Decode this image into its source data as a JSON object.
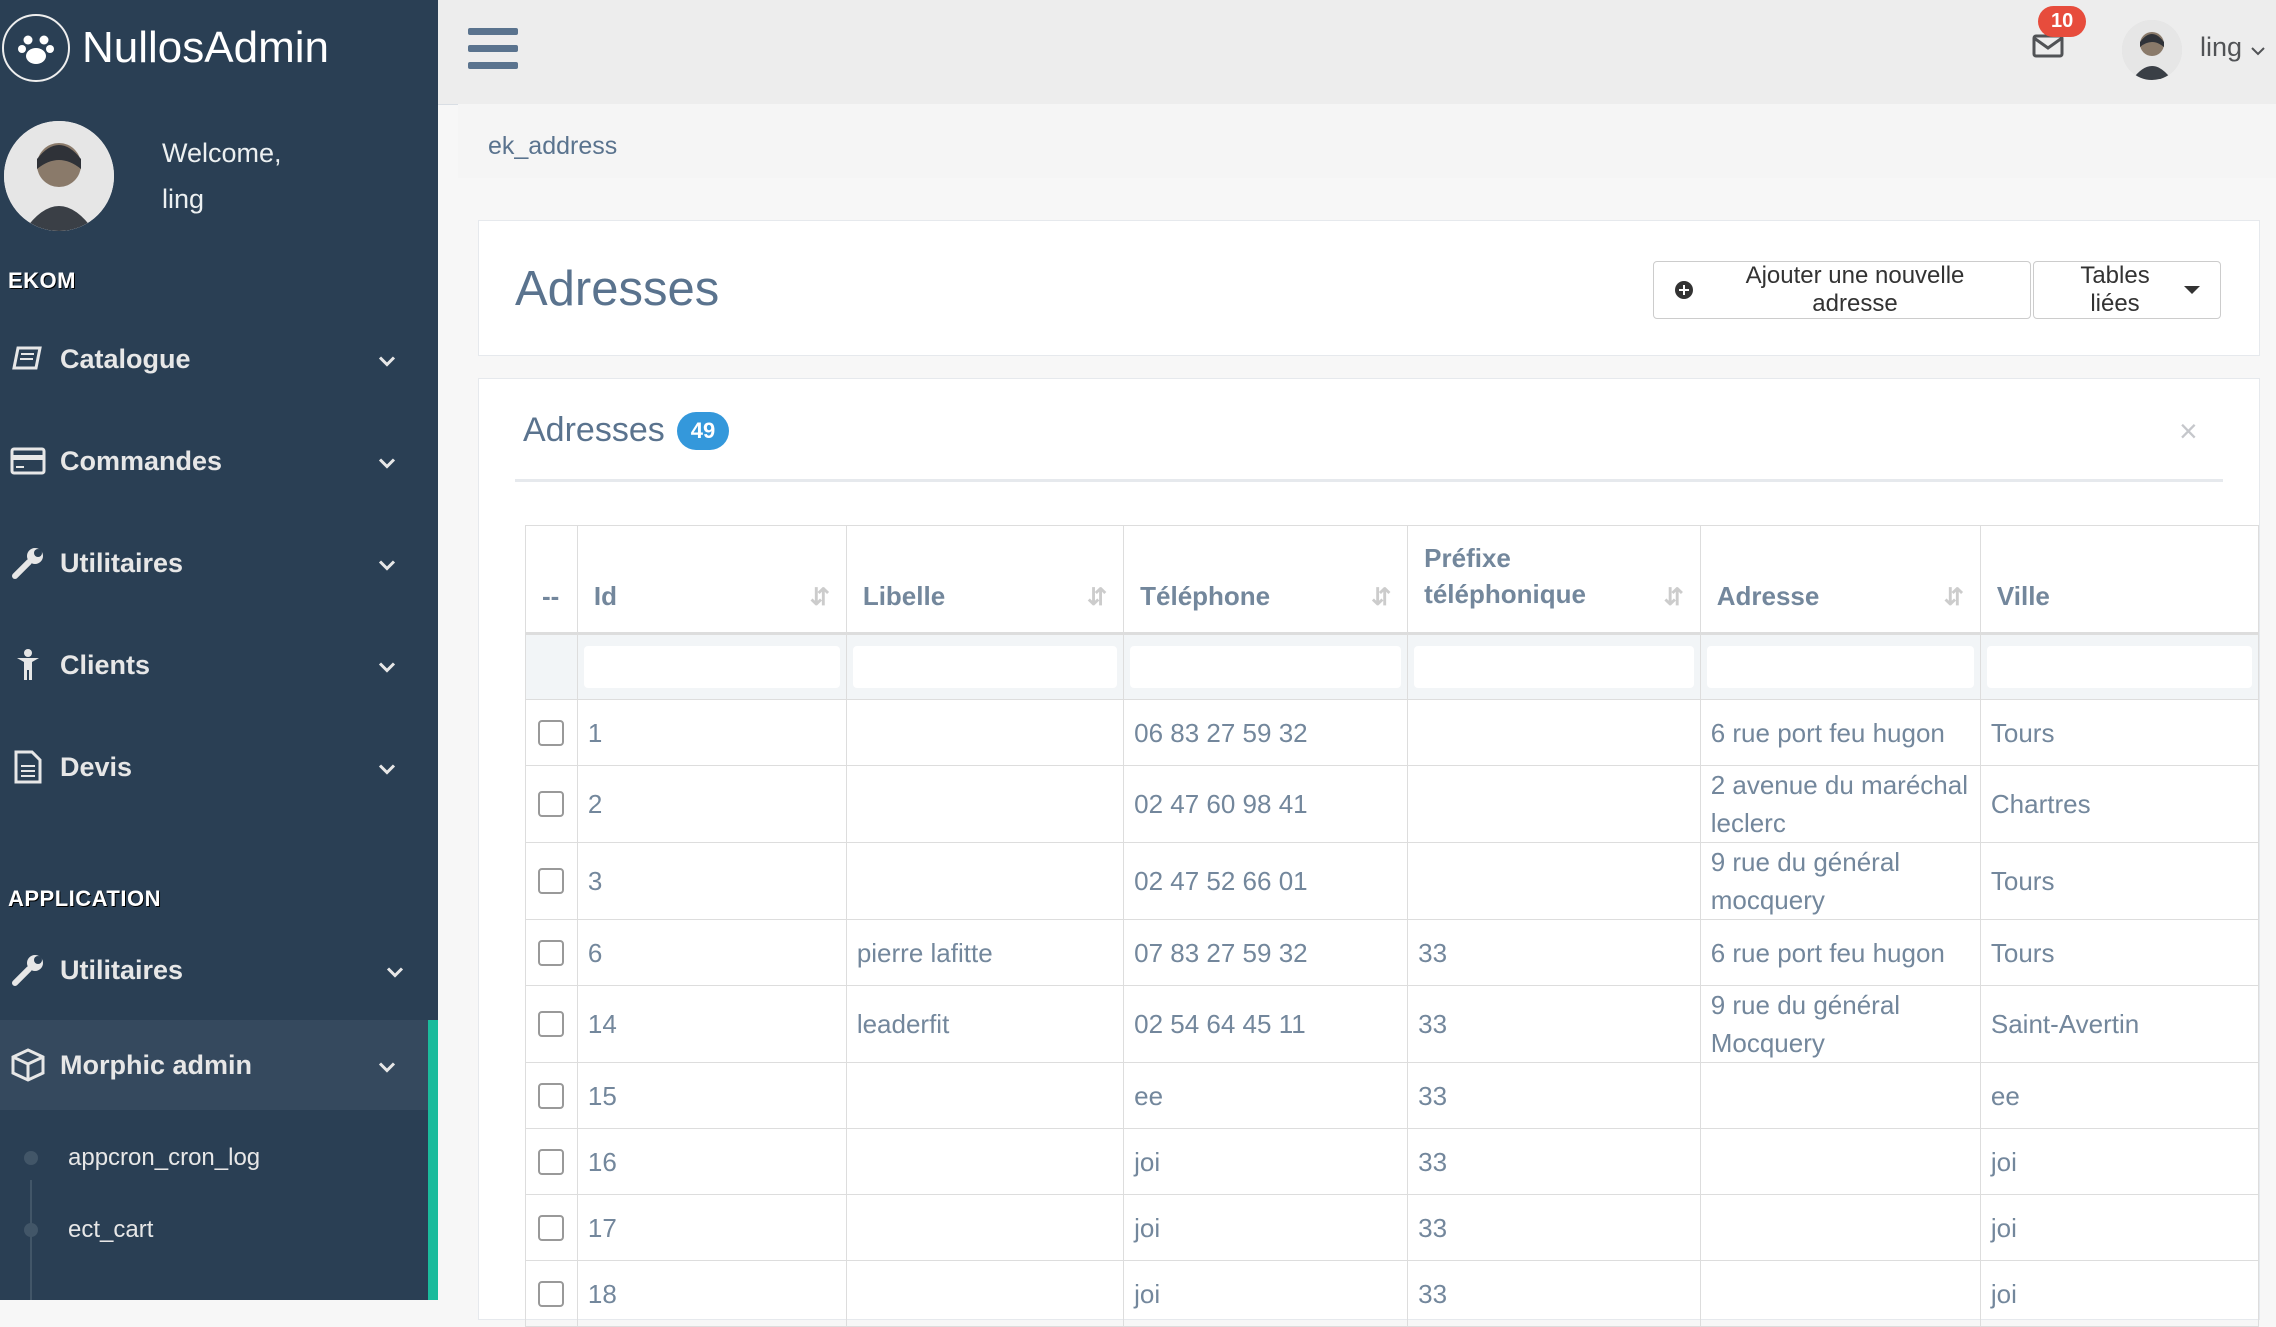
{
  "sidebar": {
    "brand": "NullosAdmin",
    "welcome": "Welcome,",
    "username": "ling",
    "sections": [
      {
        "title": "EKOM"
      },
      {
        "title": "APPLICATION"
      }
    ],
    "items": [
      {
        "label": "Catalogue",
        "icon": "book-icon"
      },
      {
        "label": "Commandes",
        "icon": "credit-card-icon"
      },
      {
        "label": "Utilitaires",
        "icon": "wrench-icon"
      },
      {
        "label": "Clients",
        "icon": "child-icon"
      },
      {
        "label": "Devis",
        "icon": "file-text-icon"
      },
      {
        "label": "Utilitaires",
        "icon": "wrench-icon"
      },
      {
        "label": "Morphic admin",
        "icon": "cube-icon"
      }
    ],
    "subitems": [
      {
        "label": "appcron_cron_log"
      },
      {
        "label": "ect_cart"
      }
    ]
  },
  "topnav": {
    "mail_count": "10",
    "username": "ling",
    "accent_red": "#E74C3C"
  },
  "breadcrumb": "ek_address",
  "header": {
    "title": "Adresses",
    "add_button": "Ajouter une nouvelle adresse",
    "tables_button": "Tables liées"
  },
  "list": {
    "title": "Adresses",
    "count": "49",
    "close": "×",
    "accent_blue": "#3498DB"
  },
  "table": {
    "columns": [
      {
        "label": "--"
      },
      {
        "label": "Id"
      },
      {
        "label": "Libelle"
      },
      {
        "label": "Téléphone"
      },
      {
        "label": "Préfixe téléphonique"
      },
      {
        "label": "Adresse"
      },
      {
        "label": "Ville"
      }
    ],
    "rows": [
      {
        "id": "1",
        "libelle": "",
        "telephone": "06 83 27 59 32",
        "prefixe": "",
        "adresse": "6 rue port feu hugon",
        "ville": "Tours"
      },
      {
        "id": "2",
        "libelle": "",
        "telephone": "02 47 60 98 41",
        "prefixe": "",
        "adresse": "2 avenue du maréchal leclerc",
        "ville": "Chartres"
      },
      {
        "id": "3",
        "libelle": "",
        "telephone": "02 47 52 66 01",
        "prefixe": "",
        "adresse": "9 rue du général mocquery",
        "ville": "Tours"
      },
      {
        "id": "6",
        "libelle": "pierre lafitte",
        "telephone": "07 83 27 59 32",
        "prefixe": "33",
        "adresse": "6 rue port feu hugon",
        "ville": "Tours"
      },
      {
        "id": "14",
        "libelle": "leaderfit",
        "telephone": "02 54 64 45 11",
        "prefixe": "33",
        "adresse": "9 rue du général Mocquery",
        "ville": "Saint-Avertin"
      },
      {
        "id": "15",
        "libelle": "",
        "telephone": "ee",
        "prefixe": "33",
        "adresse": "",
        "ville": "ee"
      },
      {
        "id": "16",
        "libelle": "",
        "telephone": "joi",
        "prefixe": "33",
        "adresse": "",
        "ville": "joi"
      },
      {
        "id": "17",
        "libelle": "",
        "telephone": "joi",
        "prefixe": "33",
        "adresse": "",
        "ville": "joi"
      },
      {
        "id": "18",
        "libelle": "",
        "telephone": "joi",
        "prefixe": "33",
        "adresse": "",
        "ville": "joi"
      }
    ]
  }
}
